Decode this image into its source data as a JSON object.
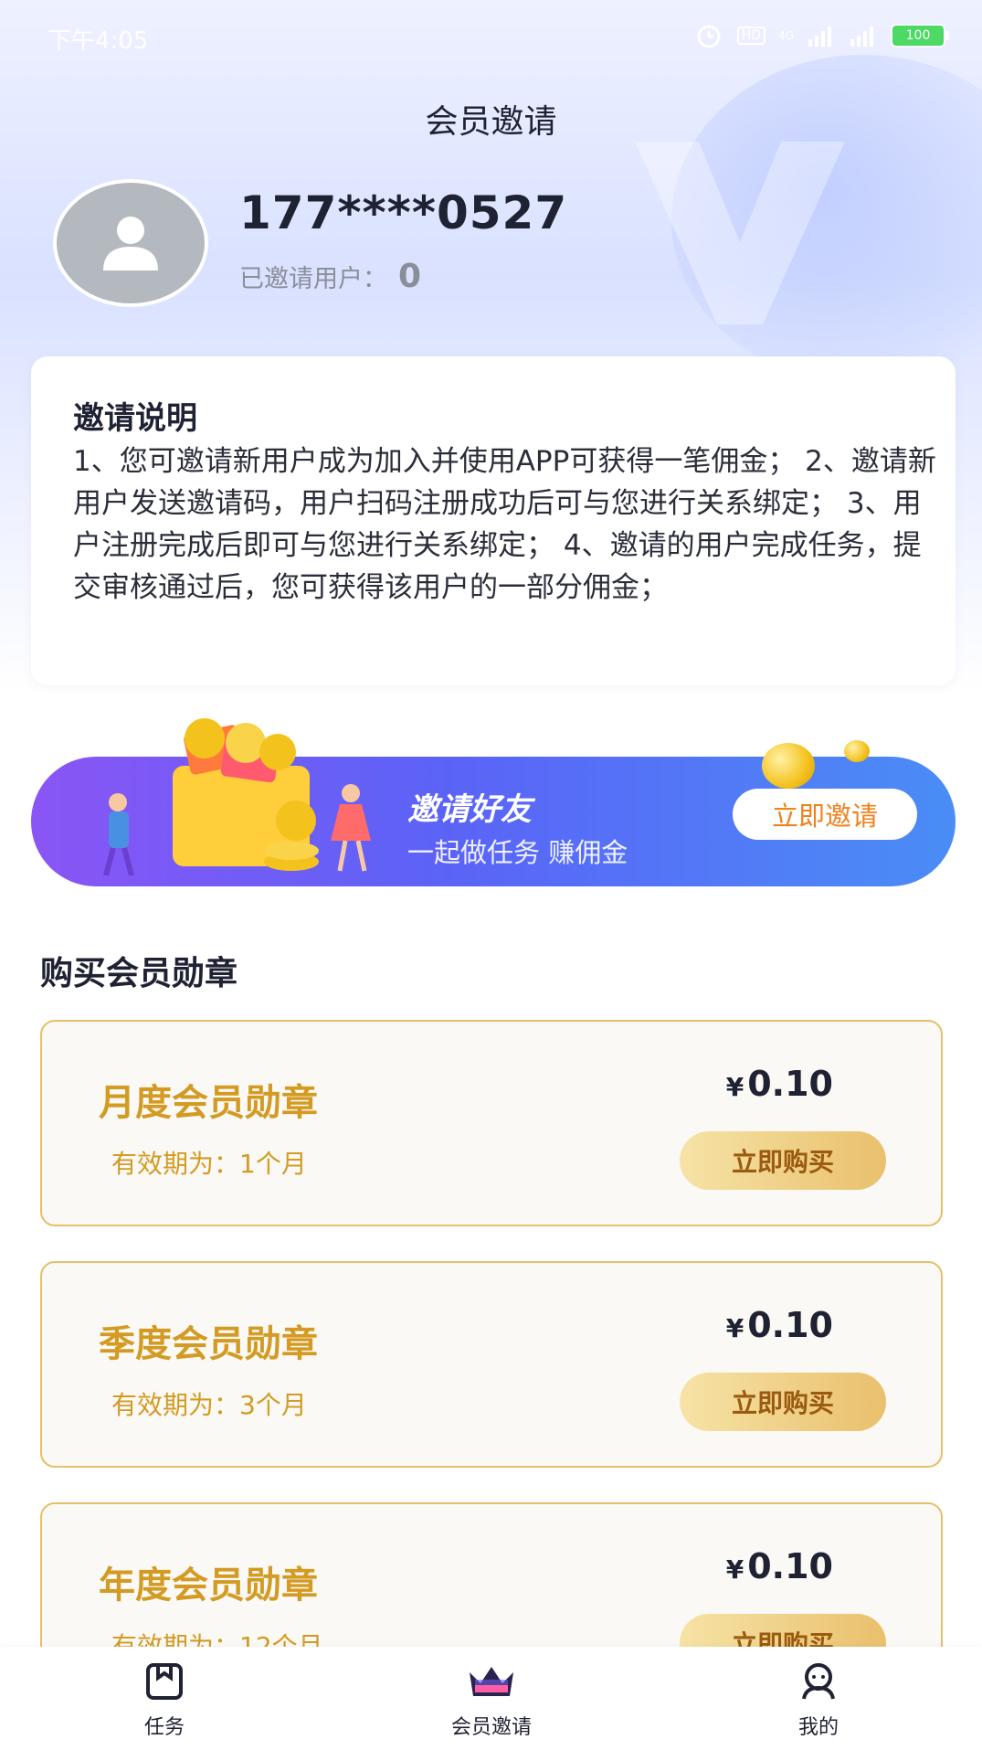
{
  "status_bar": {
    "time": "下午4:05",
    "battery": "100",
    "network": "4G",
    "hd": "HD"
  },
  "header": {
    "title": "会员邀请"
  },
  "profile": {
    "phone": "177****0527",
    "invited_label": "已邀请用户：",
    "invited_count": "0"
  },
  "invite_info": {
    "title": "邀请说明",
    "body": "1、您可邀请新用户成为加入并使用APP可获得一笔佣金； 2、邀请新用户发送邀请码，用户扫码注册成功后可与您进行关系绑定； 3、用户注册完成后即可与您进行关系绑定； 4、邀请的用户完成任务，提交审核通过后，您可获得该用户的一部分佣金；"
  },
  "banner": {
    "title": "邀请好友",
    "subtitle": "一起做任务 赚佣金",
    "button": "立即邀请"
  },
  "badges": {
    "section_title": "购买会员勋章",
    "items": [
      {
        "name": "月度会员勋章",
        "validity": "有效期为：1个月",
        "currency": "¥",
        "price": "0.10",
        "button": "立即购买"
      },
      {
        "name": "季度会员勋章",
        "validity": "有效期为：3个月",
        "currency": "¥",
        "price": "0.10",
        "button": "立即购买"
      },
      {
        "name": "年度会员勋章",
        "validity": "有效期为：12个月",
        "currency": "¥",
        "price": "0.10",
        "button": "立即购买"
      }
    ]
  },
  "tabbar": {
    "items": [
      {
        "label": "任务",
        "icon": "task-icon"
      },
      {
        "label": "会员邀请",
        "icon": "crown-icon"
      },
      {
        "label": "我的",
        "icon": "profile-icon"
      }
    ]
  },
  "colors": {
    "accent_gold": "#d39b23",
    "banner_start": "#8a55f5",
    "banner_end": "#4a8df6",
    "invite_btn_text": "#f0821e"
  }
}
